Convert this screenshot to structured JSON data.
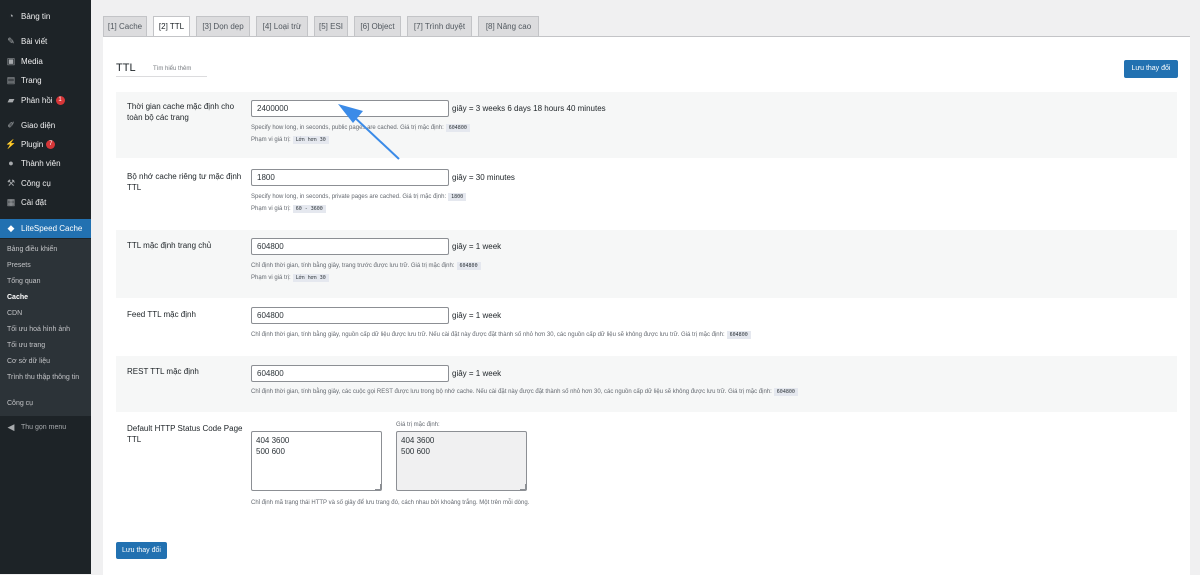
{
  "sidebar": {
    "items": [
      {
        "label": "Bảng tin",
        "icon": "dashboard-icon",
        "glyph": "◔"
      },
      {
        "label": "Bài viết",
        "icon": "pushpin-icon",
        "glyph": "✎"
      },
      {
        "label": "Media",
        "icon": "media-icon",
        "glyph": "▣"
      },
      {
        "label": "Trang",
        "icon": "page-icon",
        "glyph": "▤"
      },
      {
        "label": "Phản hồi",
        "icon": "comments-icon",
        "glyph": "▰",
        "badge": "1"
      },
      {
        "label": "Giao diện",
        "icon": "appearance-icon",
        "glyph": "✐"
      },
      {
        "label": "Plugin",
        "icon": "plugin-icon",
        "glyph": "⚡",
        "badge": "7"
      },
      {
        "label": "Thành viên",
        "icon": "users-icon",
        "glyph": "●"
      },
      {
        "label": "Công cụ",
        "icon": "tools-icon",
        "glyph": "⚒"
      },
      {
        "label": "Cài đặt",
        "icon": "settings-icon",
        "glyph": "▦"
      },
      {
        "label": "LiteSpeed Cache",
        "icon": "litespeed-icon",
        "glyph": "◆"
      }
    ],
    "submenu": [
      "Bảng điều khiển",
      "Presets",
      "Tổng quan",
      "Cache",
      "CDN",
      "Tối ưu hoá hình ảnh",
      "Tối ưu trang",
      "Cơ sở dữ liệu",
      "Trình thu thập thông tin",
      "Công cụ"
    ],
    "collapse_label": "Thu gọn menu",
    "collapse_glyph": "◀"
  },
  "tabs": [
    "[1] Cache",
    "[2] TTL",
    "[3] Dọn dẹp",
    "[4] Loại trừ",
    "[5] ESI",
    "[6] Object",
    "[7] Trình duyệt",
    "[8] Nâng cao"
  ],
  "active_tab": "[2] TTL",
  "section": {
    "title": "TTL",
    "learn_more": "Tìm hiểu thêm",
    "save_top": "Lưu thay đổi",
    "save_bottom": "Lưu thay đổi"
  },
  "settings": [
    {
      "label": "Thời gian cache mặc định cho toàn bộ các trang",
      "value": "2400000",
      "suffix": "giây = 3 weeks 6 days 18 hours 40 minutes",
      "desc": "Specify how long, in seconds, public pages are cached. Giá trị mặc định:",
      "default": "604800",
      "range_label": "Phạm vi giá trị:",
      "range": "Lớn hơn 30"
    },
    {
      "label": "Bộ nhớ cache riêng tư mặc định TTL",
      "value": "1800",
      "suffix": "giây = 30 minutes",
      "desc": "Specify how long, in seconds, private pages are cached. Giá trị mặc định:",
      "default": "1800",
      "range_label": "Phạm vi giá trị:",
      "range": "60 - 3600"
    },
    {
      "label": "TTL mặc định trang chủ",
      "value": "604800",
      "suffix": "giây = 1 week",
      "desc": "Chỉ định thời gian, tính bằng giây, trang trước được lưu trữ. Giá trị mặc định:",
      "default": "604800",
      "range_label": "Phạm vi giá trị:",
      "range": "Lớn hơn 30"
    },
    {
      "label": "Feed TTL mặc định",
      "value": "604800",
      "suffix": "giây = 1 week",
      "desc": "Chỉ định thời gian, tính bằng giây, nguồn cấp dữ liệu được lưu trữ. Nếu cài đặt này được đặt thành số nhỏ hơn 30, các nguồn cấp dữ liệu sẽ không được lưu trữ. Giá trị mặc định:",
      "default": "604800"
    },
    {
      "label": "REST TTL mặc định",
      "value": "604800",
      "suffix": "giây = 1 week",
      "desc": "Chỉ định thời gian, tính bằng giây, các cuộc gọi REST được lưu trong bộ nhớ cache. Nếu cài đặt này được đặt thành số nhỏ hơn 30, các nguồn cấp dữ liệu sẽ không được lưu trữ. Giá trị mặc định:",
      "default": "604800"
    }
  ],
  "status_code": {
    "label": "Default HTTP Status Code Page TTL",
    "value": "404 3600\n500 600",
    "default_caption": "Giá trị mặc định:",
    "default_value": "404 3600\n500 600",
    "desc": "Chỉ định mã trạng thái HTTP và số giây để lưu trang đó, cách nhau bởi khoảng trắng. Một trên mỗi dòng."
  },
  "colors": {
    "accent": "#2271b1",
    "sidebar_bg": "#1d2327",
    "badge": "#d63638",
    "annotation_arrow": "#3b8be8"
  }
}
